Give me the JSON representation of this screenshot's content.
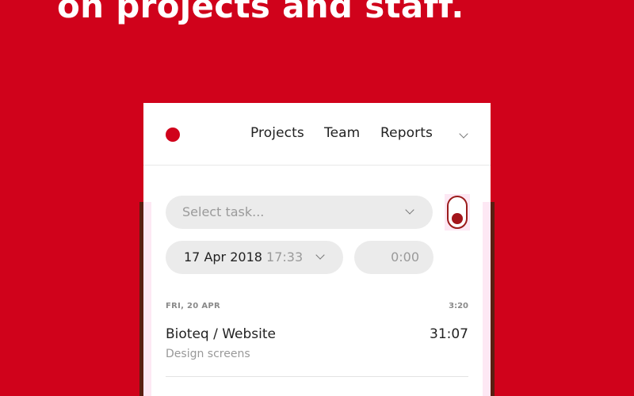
{
  "headline": "on projects and staff.",
  "nav": {
    "links": [
      "Projects",
      "Team",
      "Reports"
    ]
  },
  "tracker": {
    "task_placeholder": "Select task...",
    "date": "17 Apr 2018",
    "time": "17:33",
    "duration": "0:00",
    "running": false
  },
  "entries_day": {
    "label": "FRI, 20 APR",
    "total": "3:20",
    "entry": {
      "title": "Bioteq / Website",
      "subtitle": "Design screens",
      "duration": "31:07"
    }
  },
  "colors": {
    "brand": "#d0021b",
    "pill_bg": "#ebebeb",
    "toggle_border": "#9b1b1b"
  },
  "icons": [
    "logo-dot",
    "chevron-down-icon"
  ]
}
